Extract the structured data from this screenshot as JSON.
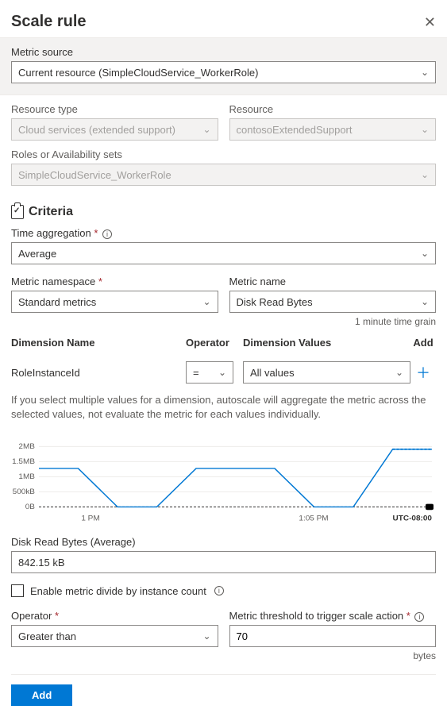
{
  "header": {
    "title": "Scale rule"
  },
  "metric_source": {
    "label": "Metric source",
    "value": "Current resource (SimpleCloudService_WorkerRole)"
  },
  "resource_type": {
    "label": "Resource type",
    "value": "Cloud services (extended support)"
  },
  "resource": {
    "label": "Resource",
    "value": "contosoExtendedSupport"
  },
  "roles": {
    "label": "Roles or Availability sets",
    "value": "SimpleCloudService_WorkerRole"
  },
  "criteria": {
    "heading": "Criteria"
  },
  "time_aggregation": {
    "label": "Time aggregation",
    "value": "Average"
  },
  "metric_namespace": {
    "label": "Metric namespace",
    "value": "Standard metrics"
  },
  "metric_name": {
    "label": "Metric name",
    "value": "Disk Read Bytes"
  },
  "time_grain": "1 minute time grain",
  "dim_headers": {
    "name": "Dimension Name",
    "op": "Operator",
    "val": "Dimension Values",
    "add": "Add"
  },
  "dim_row": {
    "name": "RoleInstanceId",
    "op": "=",
    "val": "All values"
  },
  "dim_hint": "If you select multiple values for a dimension, autoscale will aggregate the metric across the selected values, not evaluate the metric for each values individually.",
  "chart_data": {
    "type": "line",
    "title": "",
    "xlabel": "",
    "ylabel": "",
    "y_ticks": [
      "0B",
      "500kB",
      "1MB",
      "1.5MB",
      "2MB"
    ],
    "x_ticks": [
      "1 PM",
      "1:05 PM"
    ],
    "timezone": "UTC-08:00",
    "ylim": [
      0,
      2200000
    ],
    "series": [
      {
        "name": "Disk Read Bytes",
        "x": [
          0,
          1,
          2,
          3,
          4,
          5,
          6,
          7,
          8,
          9,
          10
        ],
        "values": [
          1400000,
          1400000,
          0,
          0,
          1400000,
          1400000,
          1400000,
          0,
          0,
          2100000,
          2100000
        ]
      }
    ],
    "x_tick_positions": {
      "1 PM": 2,
      "1:05 PM": 7
    }
  },
  "readout": {
    "label": "Disk Read Bytes (Average)",
    "value": "842.15 kB"
  },
  "divide_checkbox": {
    "label": "Enable metric divide by instance count",
    "checked": false
  },
  "operator": {
    "label": "Operator",
    "value": "Greater than"
  },
  "threshold": {
    "label": "Metric threshold to trigger scale action",
    "value": "70",
    "unit": "bytes"
  },
  "add_button": "Add"
}
